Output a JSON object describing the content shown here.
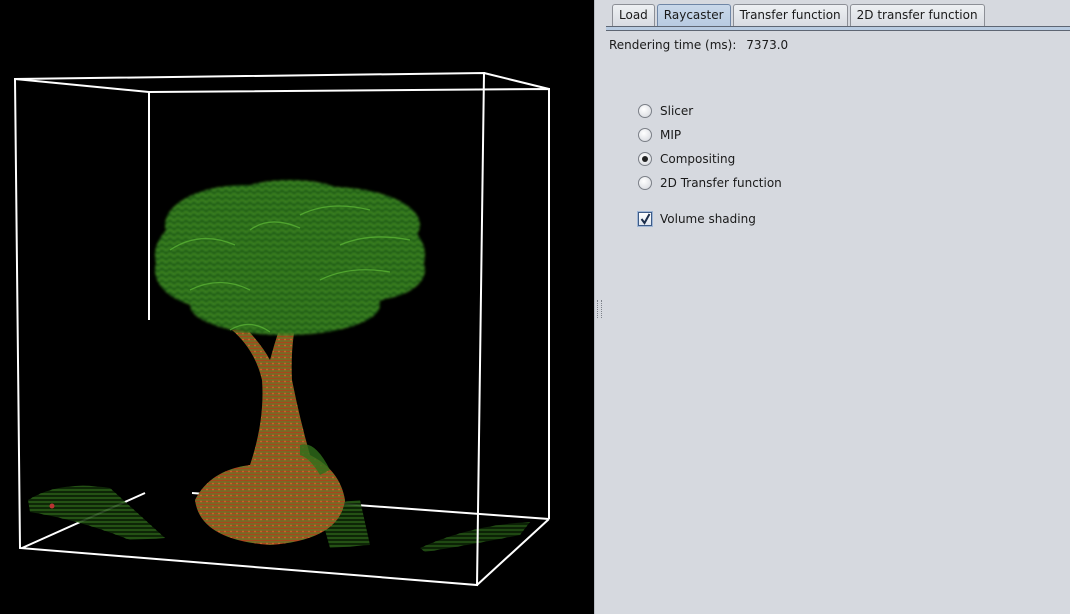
{
  "tabs": [
    {
      "label": "Load",
      "active": false
    },
    {
      "label": "Raycaster",
      "active": true
    },
    {
      "label": "Transfer function",
      "active": false
    },
    {
      "label": "2D transfer function",
      "active": false
    }
  ],
  "rendering_time": {
    "label": "Rendering time (ms):",
    "value": "7373.0"
  },
  "render_modes": [
    {
      "label": "Slicer",
      "checked": false
    },
    {
      "label": "MIP",
      "checked": false
    },
    {
      "label": "Compositing",
      "checked": true
    },
    {
      "label": "2D Transfer function",
      "checked": false
    }
  ],
  "volume_shading": {
    "label": "Volume shading",
    "checked": true
  },
  "colors": {
    "viewport_bg": "#000000",
    "foliage": "#2e7d1e",
    "trunk": "#b04e22",
    "bounding_box": "#ffffff",
    "panel_bg": "#d6d9df",
    "active_tab": "#b8cbe1"
  }
}
